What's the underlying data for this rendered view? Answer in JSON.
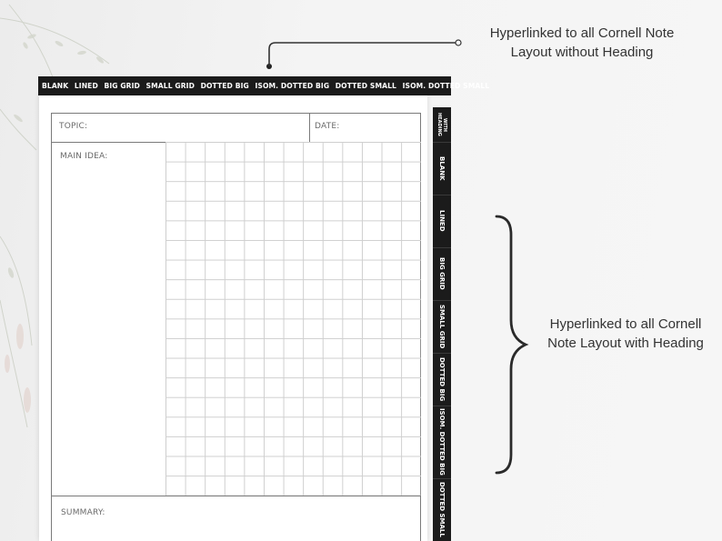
{
  "top_tabs": [
    "BLANK",
    "LINED",
    "BIG GRID",
    "SMALL GRID",
    "DOTTED BIG",
    "ISOM. DOTTED BIG",
    "DOTTED SMALL",
    "ISOM. DOTTED SMALL"
  ],
  "side_tabs": [
    "WITH HEADING",
    "BLANK",
    "LINED",
    "BIG GRID",
    "SMALL GRID",
    "DOTTED BIG",
    "ISOM. DOTTED BIG",
    "DOTTED SMALL"
  ],
  "cornell": {
    "topic_label": "TOPIC:",
    "date_label": "DATE:",
    "main_idea_label": "MAIN IDEA:",
    "summary_label": "SUMMARY:"
  },
  "annotations": {
    "top_line1": "Hyperlinked to all Cornell Note",
    "top_line2": "Layout without Heading",
    "side_line1": "Hyperlinked to all Cornell",
    "side_line2": "Note Layout with Heading"
  },
  "colors": {
    "tab_bar": "#1b1b1b",
    "tab_text": "#ffffff",
    "grid": "#cfcfcf"
  }
}
